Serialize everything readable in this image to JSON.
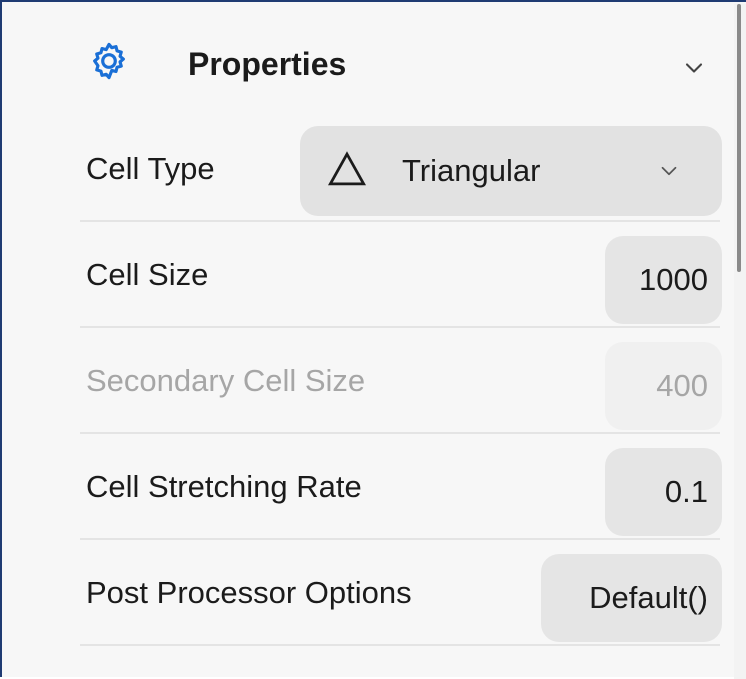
{
  "panel": {
    "title": "Properties",
    "icon": "gear-icon",
    "collapse_icon": "chevron-down-icon",
    "accent_color": "#1a6fd6"
  },
  "rows": [
    {
      "label": "Cell Type",
      "control": "dropdown",
      "value": "Triangular",
      "value_icon": "triangle-icon",
      "dropdown_icon": "chevron-down-icon",
      "enabled": true
    },
    {
      "label": "Cell Size",
      "control": "number-input",
      "value": "1000",
      "enabled": true
    },
    {
      "label": "Secondary Cell Size",
      "control": "number-input",
      "value": "400",
      "enabled": false
    },
    {
      "label": "Cell Stretching Rate",
      "control": "number-input",
      "value": "0.1",
      "enabled": true
    },
    {
      "label": "Post Processor Options",
      "control": "button",
      "value": "Default()",
      "enabled": true
    }
  ]
}
